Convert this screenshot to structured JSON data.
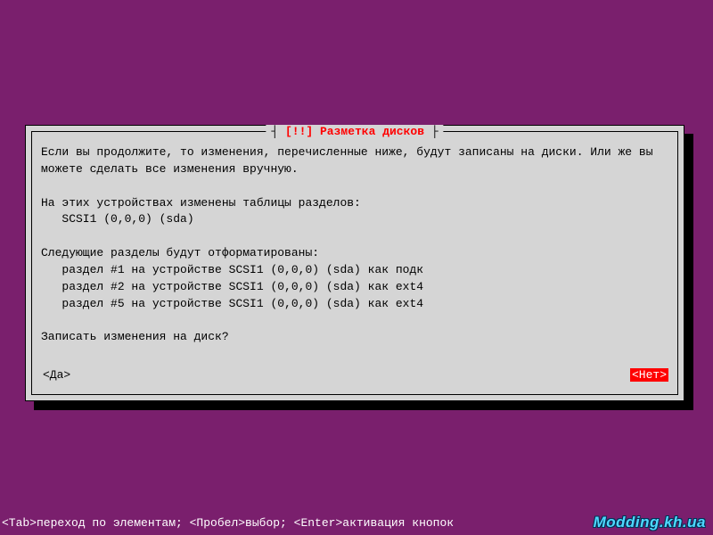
{
  "dialog": {
    "title": "[!!] Разметка дисков",
    "paragraphs": {
      "intro": "Если вы продолжите, то изменения, перечисленные ниже, будут записаны на диски. Или же вы можете сделать все изменения вручную.",
      "devices_header": "На этих устройствах изменены таблицы разделов:",
      "device1": "   SCSI1 (0,0,0) (sda)",
      "format_header": "Следующие разделы будут отформатированы:",
      "part1": "   раздел #1 на устройстве SCSI1 (0,0,0) (sda) как подк",
      "part2": "   раздел #2 на устройстве SCSI1 (0,0,0) (sda) как ext4",
      "part5": "   раздел #5 на устройстве SCSI1 (0,0,0) (sda) как ext4",
      "confirm": "Записать изменения на диск?"
    },
    "buttons": {
      "yes": "<Да>",
      "no": "<Нет>"
    }
  },
  "footer": {
    "hints": "<Tab>переход по элементам; <Пробел>выбор; <Enter>активация кнопок"
  },
  "watermark": "Modding.kh.ua"
}
